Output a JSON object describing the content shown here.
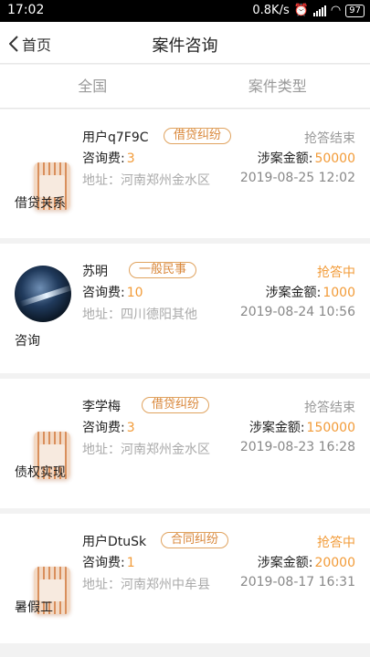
{
  "status_bar": {
    "time": "17:02",
    "network": "0.8K/s",
    "battery": "97"
  },
  "nav": {
    "back_label": "首页",
    "title": "案件咨询"
  },
  "filters": [
    "全国",
    "案件类型"
  ],
  "cases": [
    {
      "name": "用户q7F9C",
      "tag": "借贷纠纷",
      "status": "抢答结束",
      "fee_label": "咨询费:",
      "fee": "3",
      "amount_label": "涉案金额:",
      "amount": "50000",
      "address": "地址：河南郑州金水区",
      "date": "2019-08-25 12:02",
      "category": "借贷关系"
    },
    {
      "name": "苏明",
      "tag": "一般民事",
      "status": "抢答中",
      "fee_label": "咨询费:",
      "fee": "10",
      "amount_label": "涉案金额:",
      "amount": "1000",
      "address": "地址：四川德阳其他",
      "date": "2019-08-24 10:56",
      "category": "咨询"
    },
    {
      "name": "李学梅",
      "tag": "借贷纠纷",
      "status": "抢答结束",
      "fee_label": "咨询费:",
      "fee": "3",
      "amount_label": "涉案金额:",
      "amount": "150000",
      "address": "地址：河南郑州金水区",
      "date": "2019-08-23 16:28",
      "category": "债权实现"
    },
    {
      "name": "用户DtuSk",
      "tag": "合同纠纷",
      "status": "抢答中",
      "fee_label": "咨询费:",
      "fee": "1",
      "amount_label": "涉案金额:",
      "amount": "20000",
      "address": "地址：河南郑州中牟县",
      "date": "2019-08-17 16:31",
      "category": "暑假工"
    }
  ]
}
